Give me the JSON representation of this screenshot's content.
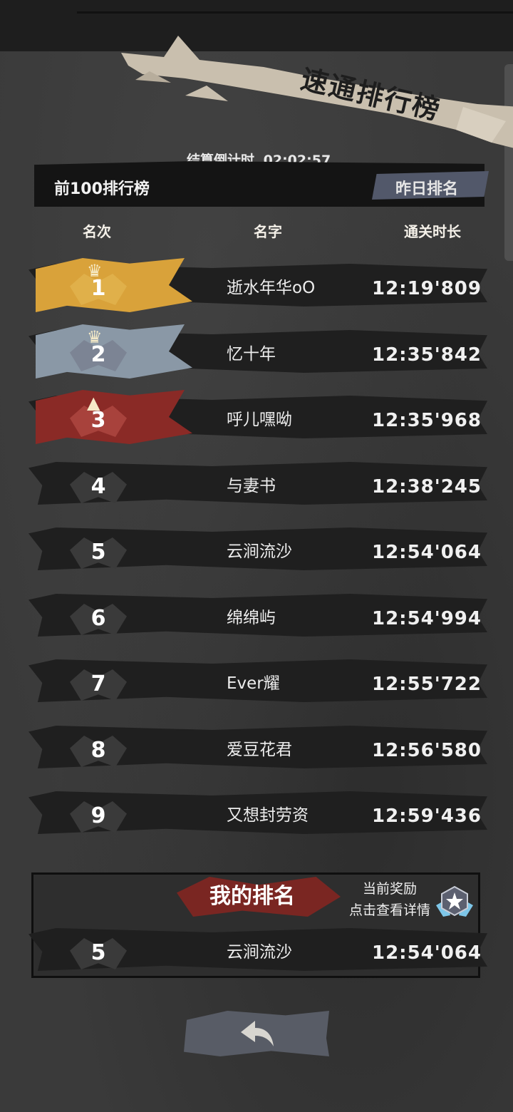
{
  "header": {
    "title": "速通排行榜",
    "countdown_label": "结算倒计时",
    "countdown_value": "02:02:57"
  },
  "tabs": {
    "top100": "前100排行榜",
    "yesterday": "昨日排名"
  },
  "columns": {
    "rank": "名次",
    "name": "名字",
    "time": "通关时长"
  },
  "leaderboard": [
    {
      "rank": "1",
      "name": "逝水年华oO",
      "time": "12:19'809"
    },
    {
      "rank": "2",
      "name": "忆十年",
      "time": "12:35'842"
    },
    {
      "rank": "3",
      "name": "呼儿嘿呦",
      "time": "12:35'968"
    },
    {
      "rank": "4",
      "name": "与妻书",
      "time": "12:38'245"
    },
    {
      "rank": "5",
      "name": "云涧流沙",
      "time": "12:54'064"
    },
    {
      "rank": "6",
      "name": "绵绵屿",
      "time": "12:54'994"
    },
    {
      "rank": "7",
      "name": "Ever耀",
      "time": "12:55'722"
    },
    {
      "rank": "8",
      "name": "爱豆花君",
      "time": "12:56'580"
    },
    {
      "rank": "9",
      "name": "又想封劳资",
      "time": "12:59'436"
    }
  ],
  "my_rank": {
    "title": "我的排名",
    "reward_line1": "当前奖励",
    "reward_line2": "点击查看详情",
    "rank": "5",
    "name": "云涧流沙",
    "time": "12:54'064"
  },
  "colors": {
    "gold": "#d9a23a",
    "silver": "#8a98a6",
    "bronze": "#8a2a26",
    "accent_red": "#7a2622",
    "banner": "#c9bfae"
  },
  "icons": {
    "back": "back-arrow-icon",
    "reward": "star-medal-icon",
    "crown": "crown-icon"
  }
}
